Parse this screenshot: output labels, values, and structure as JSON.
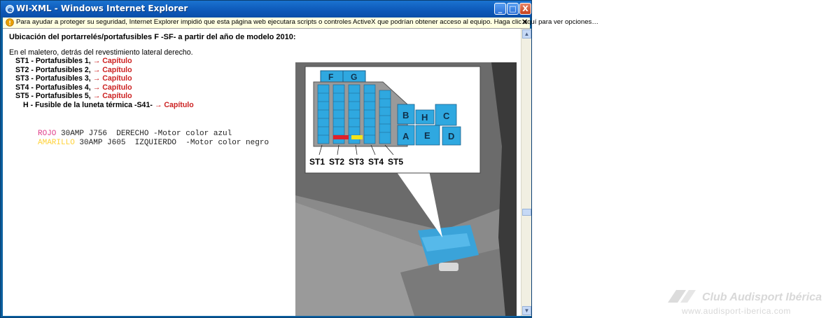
{
  "window": {
    "title": "WI-XML - Windows Internet Explorer",
    "min_btn": "_",
    "max_btn": "□",
    "close_btn": "X"
  },
  "infobar": {
    "text": "Para ayudar a proteger su seguridad, Internet Explorer impidió que esta página web ejecutara scripts o controles ActiveX que podrían obtener acceso al equipo. Haga clic aquí para ver opciones…",
    "close": "✕"
  },
  "doc": {
    "heading": "Ubicación del portarrelés/portafusibles F -SF- a partir del año de modelo 2010:",
    "intro": "En el maletero, detrás del revestimiento lateral derecho.",
    "items": [
      {
        "code": "ST1",
        "text": " - Portafusibles 1, ",
        "link": "→ Capítulo"
      },
      {
        "code": "ST2",
        "text": " - Portafusibles 2, ",
        "link": "→ Capítulo"
      },
      {
        "code": "ST3",
        "text": " - Portafusibles 3, ",
        "link": "→ Capítulo"
      },
      {
        "code": "ST4",
        "text": " - Portafusibles 4, ",
        "link": "→ Capítulo"
      },
      {
        "code": "ST5",
        "text": " - Portafusibles 5, ",
        "link": "→ Capítulo"
      },
      {
        "code": "H",
        "text": " - Fusible de la luneta térmica -S41- ",
        "link": "→ Capítulo"
      }
    ],
    "notes": [
      {
        "color_word": "ROJO",
        "rest": " 30AMP J756  DERECHO -Motor color azul"
      },
      {
        "color_word": "AMARILLO",
        "rest": " 30AMP J605  IZQUIERDO  -Motor color negro"
      }
    ]
  },
  "diagram": {
    "top_labels": [
      "F",
      "G"
    ],
    "relay_labels": [
      "B",
      "H",
      "C",
      "A",
      "E",
      "D"
    ],
    "st_labels": [
      "ST1",
      "ST2",
      "ST3",
      "ST4",
      "ST5"
    ]
  },
  "watermark": {
    "line1": "Club Audisport Ibérica",
    "line2": "www.audisport-iberica.com"
  },
  "colors": {
    "relay_blue": "#2fa8e0",
    "fuse_red": "#e0202a",
    "fuse_yellow": "#f2e31a",
    "link_red": "#cc2222"
  }
}
